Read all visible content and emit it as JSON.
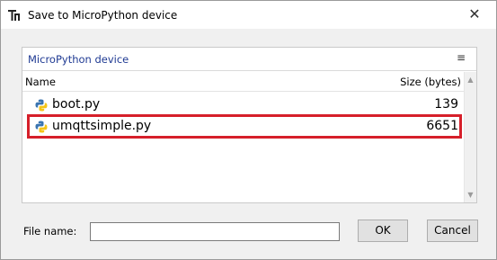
{
  "window": {
    "title": "Save to MicroPython device",
    "close_glyph": "✕",
    "app_icon": "thonny-app-icon"
  },
  "panel": {
    "title": "MicroPython device",
    "menu_glyph": "≡"
  },
  "columns": {
    "name": "Name",
    "size": "Size (bytes)"
  },
  "files": [
    {
      "name": "boot.py",
      "size": "139",
      "icon": "python-file-icon",
      "highlighted": false
    },
    {
      "name": "umqttsimple.py",
      "size": "6651",
      "icon": "python-file-icon",
      "highlighted": true
    }
  ],
  "scrollbar": {
    "up_glyph": "▲",
    "down_glyph": "▼"
  },
  "filename": {
    "label": "File name:",
    "value": "",
    "placeholder": ""
  },
  "buttons": {
    "ok": "OK",
    "cancel": "Cancel"
  },
  "colors": {
    "highlight": "#d61f2a",
    "panel_title": "#1f3a93"
  }
}
